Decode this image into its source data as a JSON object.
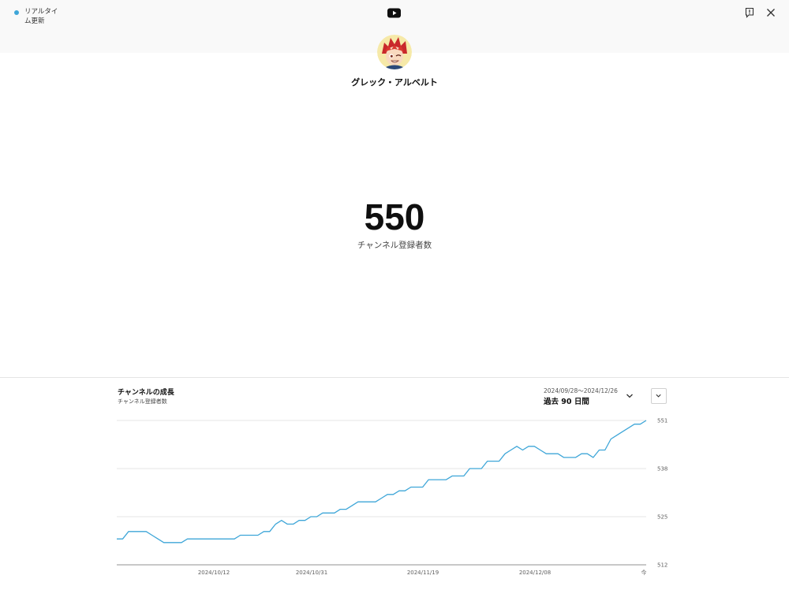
{
  "header": {
    "live_label": "リアルタイム更新",
    "logo_icon": "youtube-icon",
    "feedback_icon": "feedback-icon",
    "close_icon": "close-icon"
  },
  "channel": {
    "avatar_icon": "channel-avatar",
    "name": "グレック・アルベルト",
    "subscriber_count": "550",
    "subscriber_label": "チャンネル登録者数"
  },
  "growth": {
    "title": "チャンネルの成長",
    "subtitle": "チャンネル登録者数",
    "date_range": "2024/09/28〜2024/12/26",
    "range_label": "過去 90 日間"
  },
  "colors": {
    "accent": "#3ea6d8",
    "grid": "#e5e5e5"
  },
  "chart_data": {
    "type": "line",
    "ylim": [
      512,
      551
    ],
    "yticks": [
      "551",
      "538",
      "525",
      "512"
    ],
    "xtick_labels": [
      "2024/10/12",
      "2024/10/31",
      "2024/11/19",
      "2024/12/08",
      "今"
    ],
    "grid": true,
    "series": [
      {
        "values": [
          519,
          519,
          521,
          521,
          521,
          521,
          520,
          519,
          518,
          518,
          518,
          518,
          519,
          519,
          519,
          519,
          519,
          519,
          519,
          519,
          519,
          520,
          520,
          520,
          520,
          521,
          521,
          523,
          524,
          523,
          523,
          524,
          524,
          525,
          525,
          526,
          526,
          526,
          527,
          527,
          528,
          529,
          529,
          529,
          529,
          530,
          531,
          531,
          532,
          532,
          533,
          533,
          533,
          535,
          535,
          535,
          535,
          536,
          536,
          536,
          538,
          538,
          538,
          540,
          540,
          540,
          542,
          543,
          544,
          543,
          544,
          544,
          543,
          542,
          542,
          542,
          541,
          541,
          541,
          542,
          542,
          541,
          543,
          543,
          546,
          547,
          548,
          549,
          550,
          550,
          551
        ]
      }
    ]
  }
}
